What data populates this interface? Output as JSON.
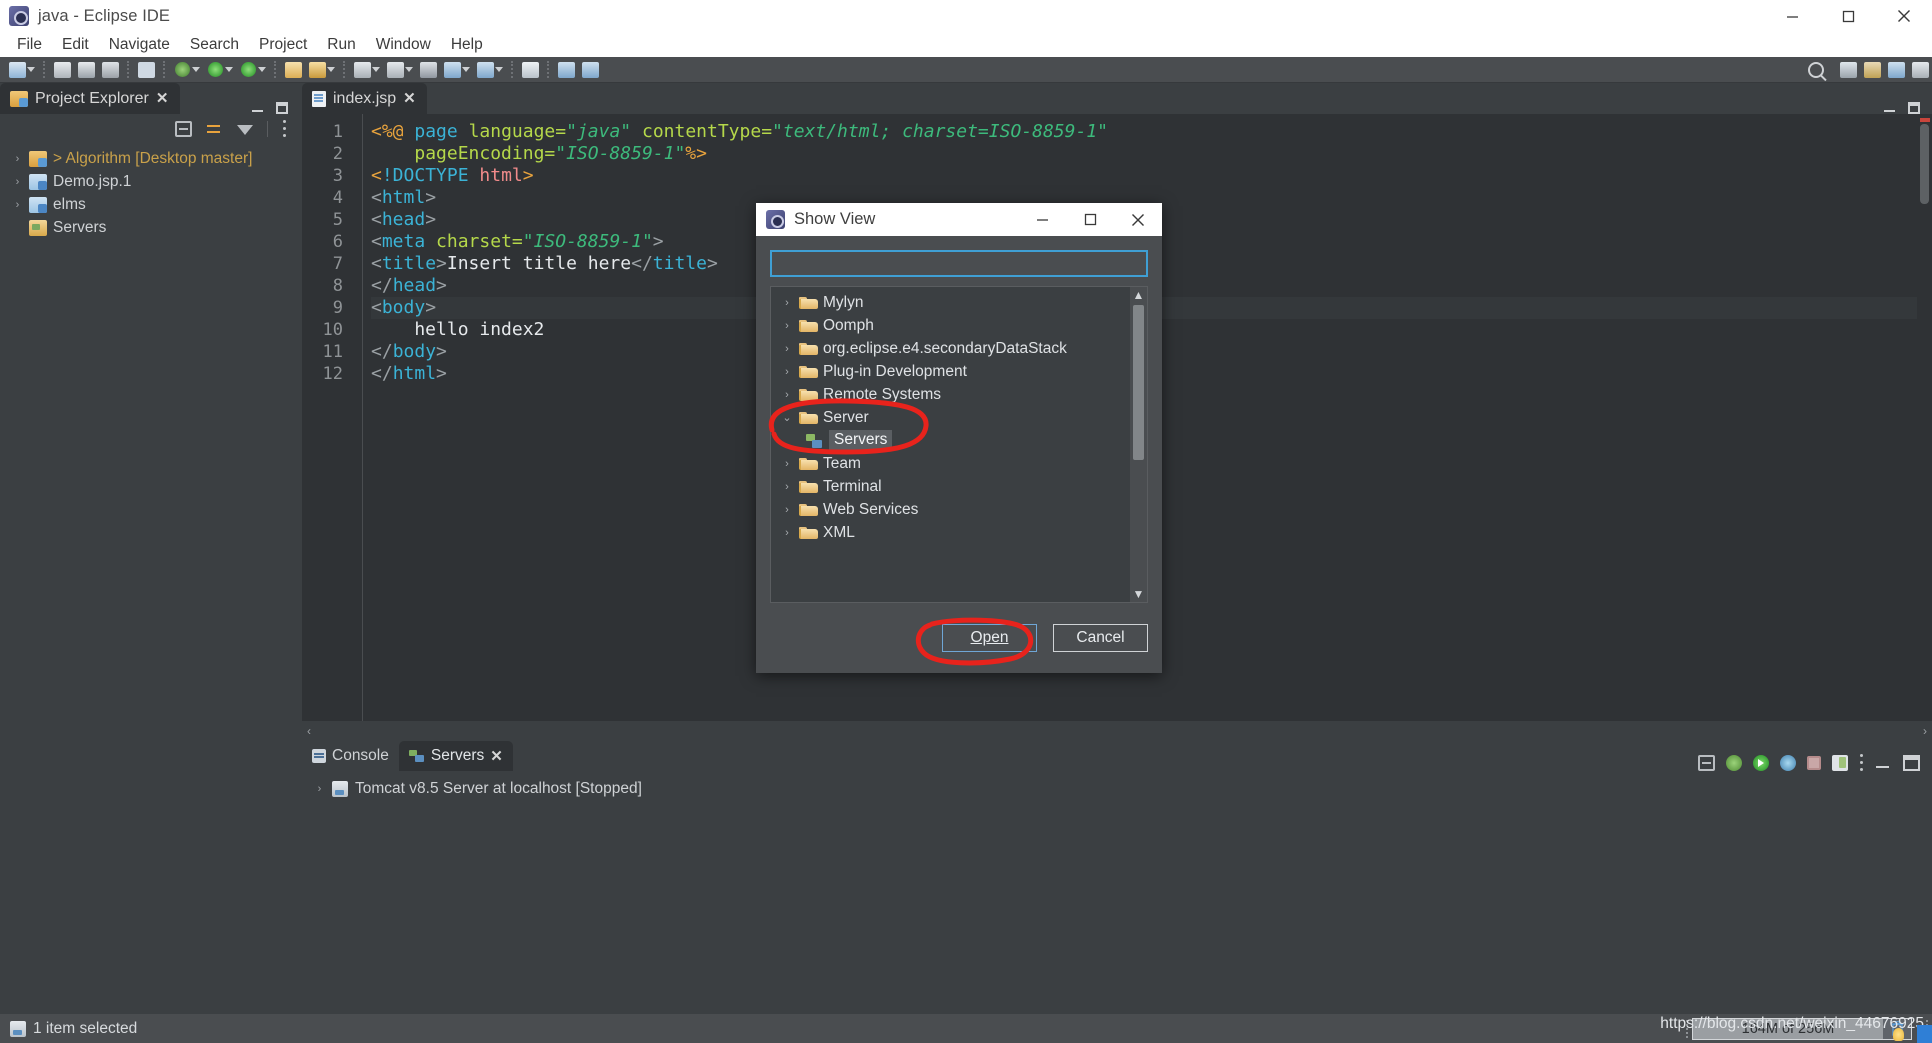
{
  "window": {
    "title": "java - Eclipse IDE",
    "app_icon": "eclipse-icon",
    "minimize": "minimize-icon",
    "maximize": "maximize-icon",
    "close": "close-icon"
  },
  "menubar": {
    "items": [
      "File",
      "Edit",
      "Navigate",
      "Search",
      "Project",
      "Run",
      "Window",
      "Help"
    ]
  },
  "toolbar": {
    "search_icon": "search-icon"
  },
  "explorer": {
    "tab_label": "Project Explorer",
    "tab_close": "close-icon",
    "toolbar": {
      "collapse_all": "collapse-all-icon",
      "link_with_editor": "link-with-editor-icon",
      "view_filter": "filter-icon",
      "view_menu": "view-menu-icon"
    },
    "tree": [
      {
        "label": "> Algorithm [Desktop master]",
        "icon": "java-project-icon",
        "arrow": "›",
        "accent": true
      },
      {
        "label": "Demo.jsp.1",
        "icon": "web-project-icon",
        "arrow": "›",
        "accent": false
      },
      {
        "label": "elms",
        "icon": "web-project-icon",
        "arrow": "›",
        "accent": false
      },
      {
        "label": "Servers",
        "icon": "servers-folder-icon",
        "arrow": "",
        "accent": false
      }
    ]
  },
  "editor": {
    "tab": {
      "label": "index.jsp",
      "icon": "jsp-file-icon",
      "close": "close-icon"
    },
    "current_line": 9,
    "lines": [
      {
        "n": 1,
        "fold": false,
        "tokens": [
          {
            "t": "<%@",
            "c": "k-jsp"
          },
          {
            "t": " ",
            "c": "k-text"
          },
          {
            "t": "page",
            "c": "k-tag"
          },
          {
            "t": " ",
            "c": "k-text"
          },
          {
            "t": "language=",
            "c": "k-attr"
          },
          {
            "t": "\"java\"",
            "c": "k-str"
          },
          {
            "t": " ",
            "c": "k-text"
          },
          {
            "t": "contentType=",
            "c": "k-attr"
          },
          {
            "t": "\"text/html; charset=ISO-8859-1\"",
            "c": "k-str"
          }
        ]
      },
      {
        "n": 2,
        "fold": false,
        "tokens": [
          {
            "t": "    ",
            "c": "k-text"
          },
          {
            "t": "pageEncoding=",
            "c": "k-attr"
          },
          {
            "t": "\"ISO-8859-1\"",
            "c": "k-str"
          },
          {
            "t": "%>",
            "c": "k-jsp"
          }
        ]
      },
      {
        "n": 3,
        "fold": false,
        "tokens": [
          {
            "t": "<",
            "c": "k-jsp"
          },
          {
            "t": "!DOCTYPE",
            "c": "k-tag"
          },
          {
            "t": " ",
            "c": "k-text"
          },
          {
            "t": "html",
            "c": "k-pink"
          },
          {
            "t": ">",
            "c": "k-jsp"
          }
        ]
      },
      {
        "n": 4,
        "fold": true,
        "tokens": [
          {
            "t": "<",
            "c": "k-punct"
          },
          {
            "t": "html",
            "c": "k-tag"
          },
          {
            "t": ">",
            "c": "k-punct"
          }
        ]
      },
      {
        "n": 5,
        "fold": true,
        "tokens": [
          {
            "t": "<",
            "c": "k-punct"
          },
          {
            "t": "head",
            "c": "k-tag"
          },
          {
            "t": ">",
            "c": "k-punct"
          }
        ]
      },
      {
        "n": 6,
        "fold": false,
        "tokens": [
          {
            "t": "<",
            "c": "k-punct"
          },
          {
            "t": "meta",
            "c": "k-tag"
          },
          {
            "t": " ",
            "c": "k-text"
          },
          {
            "t": "charset=",
            "c": "k-attr"
          },
          {
            "t": "\"ISO-8859-1\"",
            "c": "k-str"
          },
          {
            "t": ">",
            "c": "k-punct"
          }
        ]
      },
      {
        "n": 7,
        "fold": false,
        "tokens": [
          {
            "t": "<",
            "c": "k-punct"
          },
          {
            "t": "title",
            "c": "k-tag"
          },
          {
            "t": ">",
            "c": "k-punct"
          },
          {
            "t": "Insert title here",
            "c": "k-text"
          },
          {
            "t": "</",
            "c": "k-punct"
          },
          {
            "t": "title",
            "c": "k-tag"
          },
          {
            "t": ">",
            "c": "k-punct"
          }
        ]
      },
      {
        "n": 8,
        "fold": false,
        "tokens": [
          {
            "t": "</",
            "c": "k-punct"
          },
          {
            "t": "head",
            "c": "k-tag"
          },
          {
            "t": ">",
            "c": "k-punct"
          }
        ]
      },
      {
        "n": 9,
        "fold": true,
        "tokens": [
          {
            "t": "<",
            "c": "k-punct"
          },
          {
            "t": "body",
            "c": "k-tag"
          },
          {
            "t": ">",
            "c": "k-punct"
          }
        ]
      },
      {
        "n": 10,
        "fold": false,
        "tokens": [
          {
            "t": "    hello index2",
            "c": "k-text"
          }
        ]
      },
      {
        "n": 11,
        "fold": false,
        "tokens": [
          {
            "t": "</",
            "c": "k-punct"
          },
          {
            "t": "body",
            "c": "k-tag"
          },
          {
            "t": ">",
            "c": "k-punct"
          }
        ]
      },
      {
        "n": 12,
        "fold": false,
        "tokens": [
          {
            "t": "</",
            "c": "k-punct"
          },
          {
            "t": "html",
            "c": "k-tag"
          },
          {
            "t": ">",
            "c": "k-punct"
          }
        ]
      }
    ],
    "scroll_left_arrow": "‹",
    "scroll_right_arrow": "›"
  },
  "bottom_view": {
    "tabs": [
      {
        "label": "Console",
        "icon": "console-icon",
        "active": false,
        "closeable": false
      },
      {
        "label": "Servers",
        "icon": "servers-icon",
        "active": true,
        "closeable": true
      }
    ],
    "tab_close": "close-icon",
    "toolbar": [
      "collapse-all-icon",
      "debug-server-icon",
      "start-server-icon",
      "profile-server-icon",
      "stop-server-icon",
      "publish-icon",
      "view-menu-icon",
      "minimize-icon",
      "maximize-icon"
    ],
    "rows": [
      {
        "arrow": "›",
        "icon": "server-icon",
        "label": "Tomcat v8.5 Server at localhost  [Stopped]"
      }
    ]
  },
  "dialog": {
    "title": "Show View",
    "icon": "eclipse-icon",
    "minimize": "minimize-icon",
    "maximize": "maximize-icon",
    "close": "close-icon",
    "filter": {
      "value": "",
      "placeholder": ""
    },
    "tree": [
      {
        "label": "Mylyn",
        "icon": "folder-icon",
        "arrow": "›",
        "level": 0,
        "selected": false
      },
      {
        "label": "Oomph",
        "icon": "folder-icon",
        "arrow": "›",
        "level": 0,
        "selected": false
      },
      {
        "label": "org.eclipse.e4.secondaryDataStack",
        "icon": "folder-icon",
        "arrow": "›",
        "level": 0,
        "selected": false
      },
      {
        "label": "Plug-in Development",
        "icon": "folder-icon",
        "arrow": "›",
        "level": 0,
        "selected": false
      },
      {
        "label": "Remote Systems",
        "icon": "folder-icon",
        "arrow": "›",
        "level": 0,
        "selected": false
      },
      {
        "label": "Server",
        "icon": "folder-icon",
        "arrow": "⌄",
        "level": 0,
        "selected": false
      },
      {
        "label": "Servers",
        "icon": "servers-view-icon",
        "arrow": "",
        "level": 1,
        "selected": true
      },
      {
        "label": "Team",
        "icon": "folder-icon",
        "arrow": "›",
        "level": 0,
        "selected": false
      },
      {
        "label": "Terminal",
        "icon": "folder-icon",
        "arrow": "›",
        "level": 0,
        "selected": false
      },
      {
        "label": "Web Services",
        "icon": "folder-icon",
        "arrow": "›",
        "level": 0,
        "selected": false
      },
      {
        "label": "XML",
        "icon": "folder-icon",
        "arrow": "›",
        "level": 0,
        "selected": false
      }
    ],
    "scroll_up": "▲",
    "scroll_down": "▼",
    "buttons": {
      "open": "Open",
      "open_mnemonic": "O",
      "cancel": "Cancel"
    }
  },
  "statusbar": {
    "icon": "selection-icon",
    "text": "1 item selected",
    "heap": {
      "label": "164M of 256M",
      "trash_icon": "trash-icon"
    },
    "watermark": "https://blog.csdn.net/weixin_44676925"
  },
  "annotations": {
    "color": "#e8231c",
    "shapes": [
      "ellipse-around-server-servers",
      "ellipse-around-open-button"
    ]
  }
}
